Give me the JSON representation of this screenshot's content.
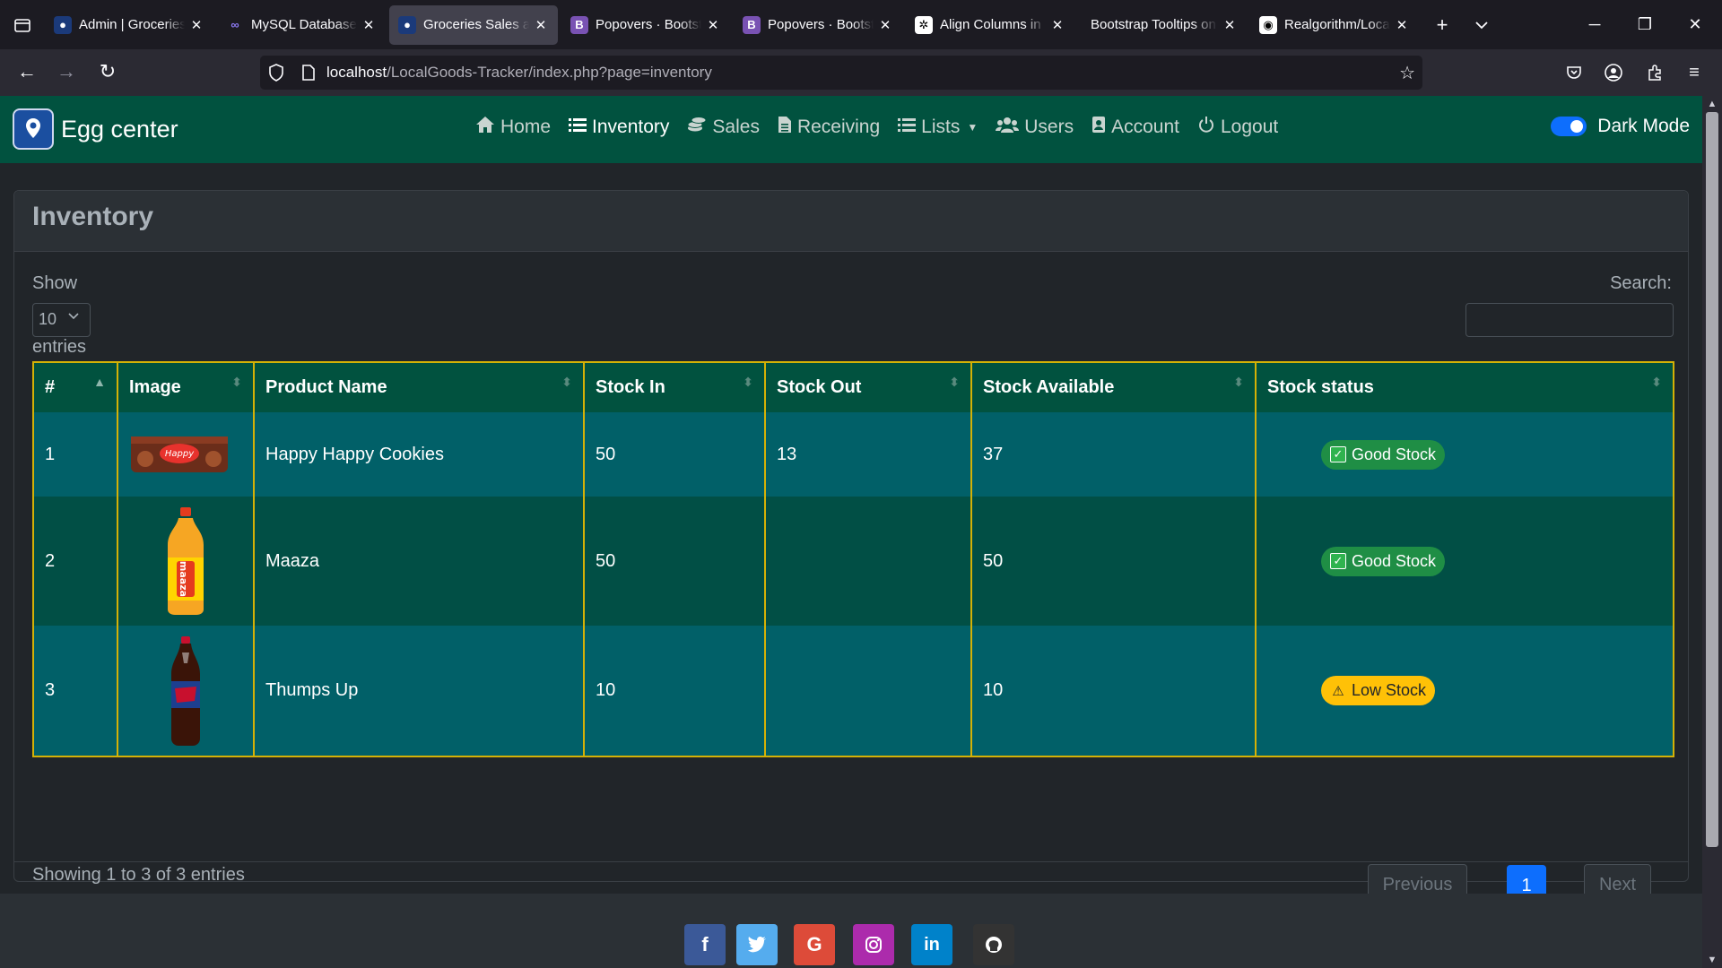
{
  "browser": {
    "tabs": [
      {
        "title": "Admin | Groceries",
        "favicon": "egg-center-logo-icon",
        "active": false
      },
      {
        "title": "MySQL Databases",
        "favicon": "infinity-icon",
        "active": false
      },
      {
        "title": "Groceries Sales and",
        "favicon": "egg-center-logo-icon",
        "active": true
      },
      {
        "title": "Popovers · Bootstrap",
        "favicon": "bootstrap-icon",
        "active": false
      },
      {
        "title": "Popovers · Bootstrap",
        "favicon": "bootstrap-icon",
        "active": false
      },
      {
        "title": "Align Columns in B",
        "favicon": "chatgpt-icon",
        "active": false
      },
      {
        "title": "Bootstrap Tooltips on",
        "favicon": "",
        "active": false
      },
      {
        "title": "Realgorithm/Local",
        "favicon": "github-icon",
        "active": false
      }
    ],
    "url_host": "localhost",
    "url_path": "/LocalGoods-Tracker/index.php?page=inventory"
  },
  "app": {
    "brand": "Egg center",
    "nav": [
      {
        "label": "Home",
        "icon": "home-icon"
      },
      {
        "label": "Inventory",
        "icon": "list-icon",
        "active": true
      },
      {
        "label": "Sales",
        "icon": "coins-icon"
      },
      {
        "label": "Receiving",
        "icon": "file-icon"
      },
      {
        "label": "Lists",
        "icon": "list-icon",
        "dropdown": true
      },
      {
        "label": "Users",
        "icon": "users-icon"
      },
      {
        "label": "Account",
        "icon": "id-badge-icon"
      },
      {
        "label": "Logout",
        "icon": "power-icon"
      }
    ],
    "dark_mode_label": "Dark Mode",
    "dark_mode_on": true
  },
  "inventory": {
    "title": "Inventory",
    "show_label": "Show",
    "page_length": "10",
    "entries_label": "entries",
    "search_label": "Search:",
    "search_value": "",
    "columns": [
      "#",
      "Image",
      "Product Name",
      "Stock In",
      "Stock Out",
      "Stock Available",
      "Stock status"
    ],
    "rows": [
      {
        "num": "1",
        "image": "cookie-pack-image",
        "name": "Happy Happy Cookies",
        "stock_in": "50",
        "stock_out": "13",
        "available": "37",
        "status": "Good Stock",
        "status_type": "good"
      },
      {
        "num": "2",
        "image": "maaza-bottle-image",
        "name": "Maaza",
        "stock_in": "50",
        "stock_out": "",
        "available": "50",
        "status": "Good Stock",
        "status_type": "good"
      },
      {
        "num": "3",
        "image": "thums-up-bottle-image",
        "name": "Thumps Up",
        "stock_in": "10",
        "stock_out": "",
        "available": "10",
        "status": "Low Stock",
        "status_type": "low"
      }
    ],
    "info": "Showing 1 to 3 of 3 entries",
    "pagination": {
      "previous": "Previous",
      "current": "1",
      "next": "Next"
    }
  },
  "footer": {
    "social": [
      "facebook-icon",
      "twitter-icon",
      "google-icon",
      "instagram-icon",
      "linkedin-icon",
      "github-icon"
    ]
  },
  "colors": {
    "navbar": "#01523f",
    "row_odd": "#016068",
    "row_even": "#014f45",
    "table_border": "#d4b106",
    "good": "#1f8e45",
    "low": "#ffc107",
    "primary": "#0d6efd"
  }
}
